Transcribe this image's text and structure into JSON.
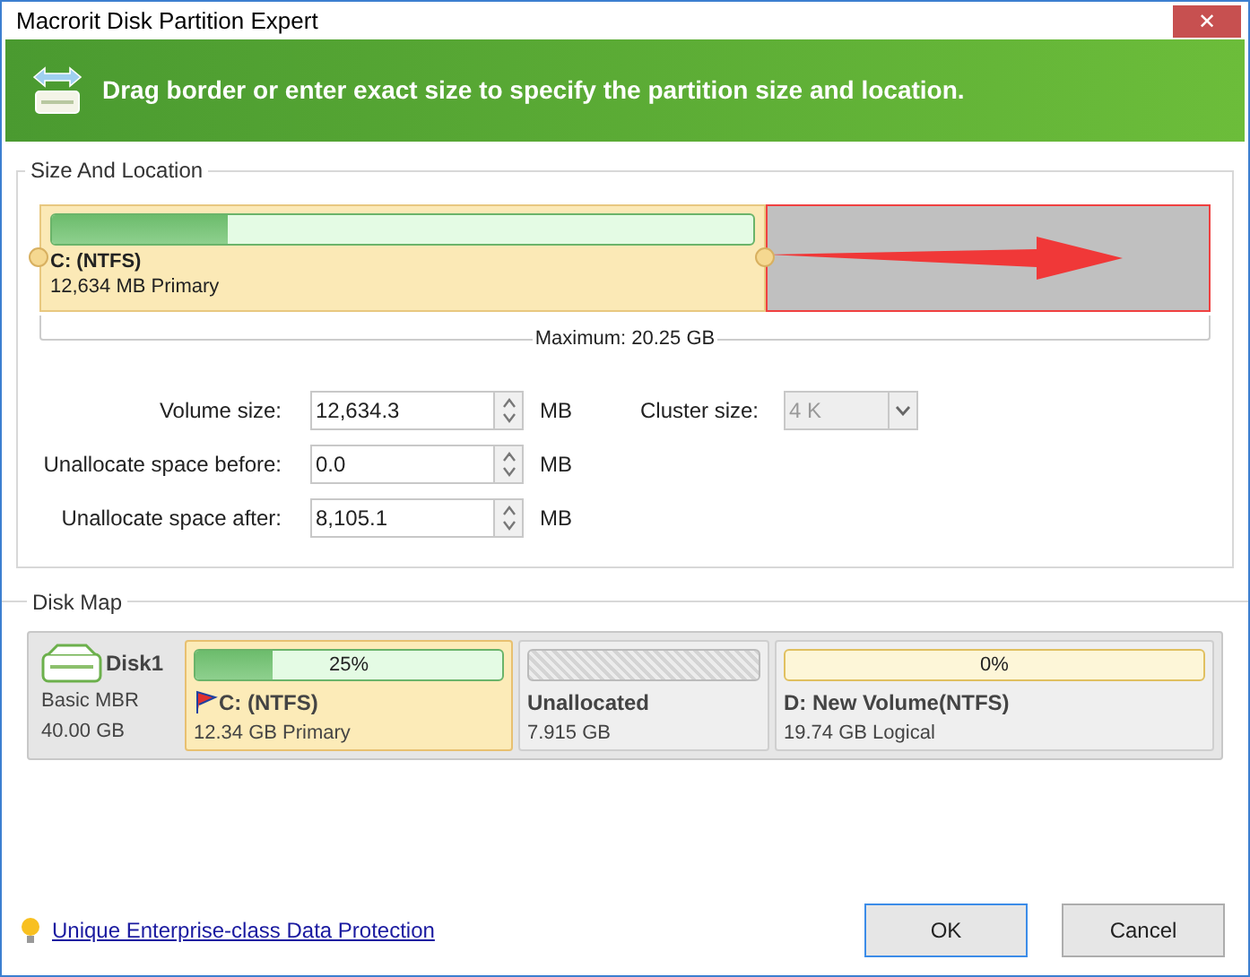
{
  "window": {
    "title": "Macrorit Disk Partition Expert",
    "close": "✕"
  },
  "banner": {
    "text": "Drag border or enter exact size to specify the partition size and location."
  },
  "size_and_location": {
    "title": "Size And Location",
    "partition_bar": {
      "name": "C: (NTFS)",
      "detail": "12,634 MB Primary",
      "level": 0.62,
      "usage": {
        "level": 0.25
      },
      "maximum": "Maximum: 20.25 GB"
    },
    "fields": [
      {
        "label": "Volume size:",
        "value": "12,634.3",
        "unit": "MB"
      },
      {
        "label": "Unallocate space before:",
        "value": "0.0",
        "unit": "MB"
      },
      {
        "label": "Unallocate space after:",
        "value": "8,105.1",
        "unit": "MB"
      }
    ],
    "cluster_size": {
      "label": "Cluster size:",
      "value": "4 K",
      "disabled": true
    }
  },
  "disk_map": {
    "title": "Disk Map",
    "disk": {
      "name": "Disk1",
      "type": "Basic MBR",
      "size": "40.00 GB"
    },
    "partitions": [
      {
        "kind": "partition",
        "name": "C: (NTFS)",
        "detail": "12.34 GB Primary",
        "usage": "25%",
        "level": 0.25,
        "selected": true,
        "boot": true
      },
      {
        "kind": "unallocated",
        "name": "Unallocated",
        "detail": "7.915 GB",
        "selected": false
      },
      {
        "kind": "partition",
        "name": "D: New Volume(NTFS)",
        "detail": "19.74 GB Logical",
        "usage": "0%",
        "level": 0,
        "selected": false,
        "boot": false
      }
    ]
  },
  "footer": {
    "link": "Unique Enterprise-class Data Protection",
    "buttons": [
      {
        "label": "OK",
        "default": true
      },
      {
        "label": "Cancel",
        "default": false
      }
    ]
  }
}
